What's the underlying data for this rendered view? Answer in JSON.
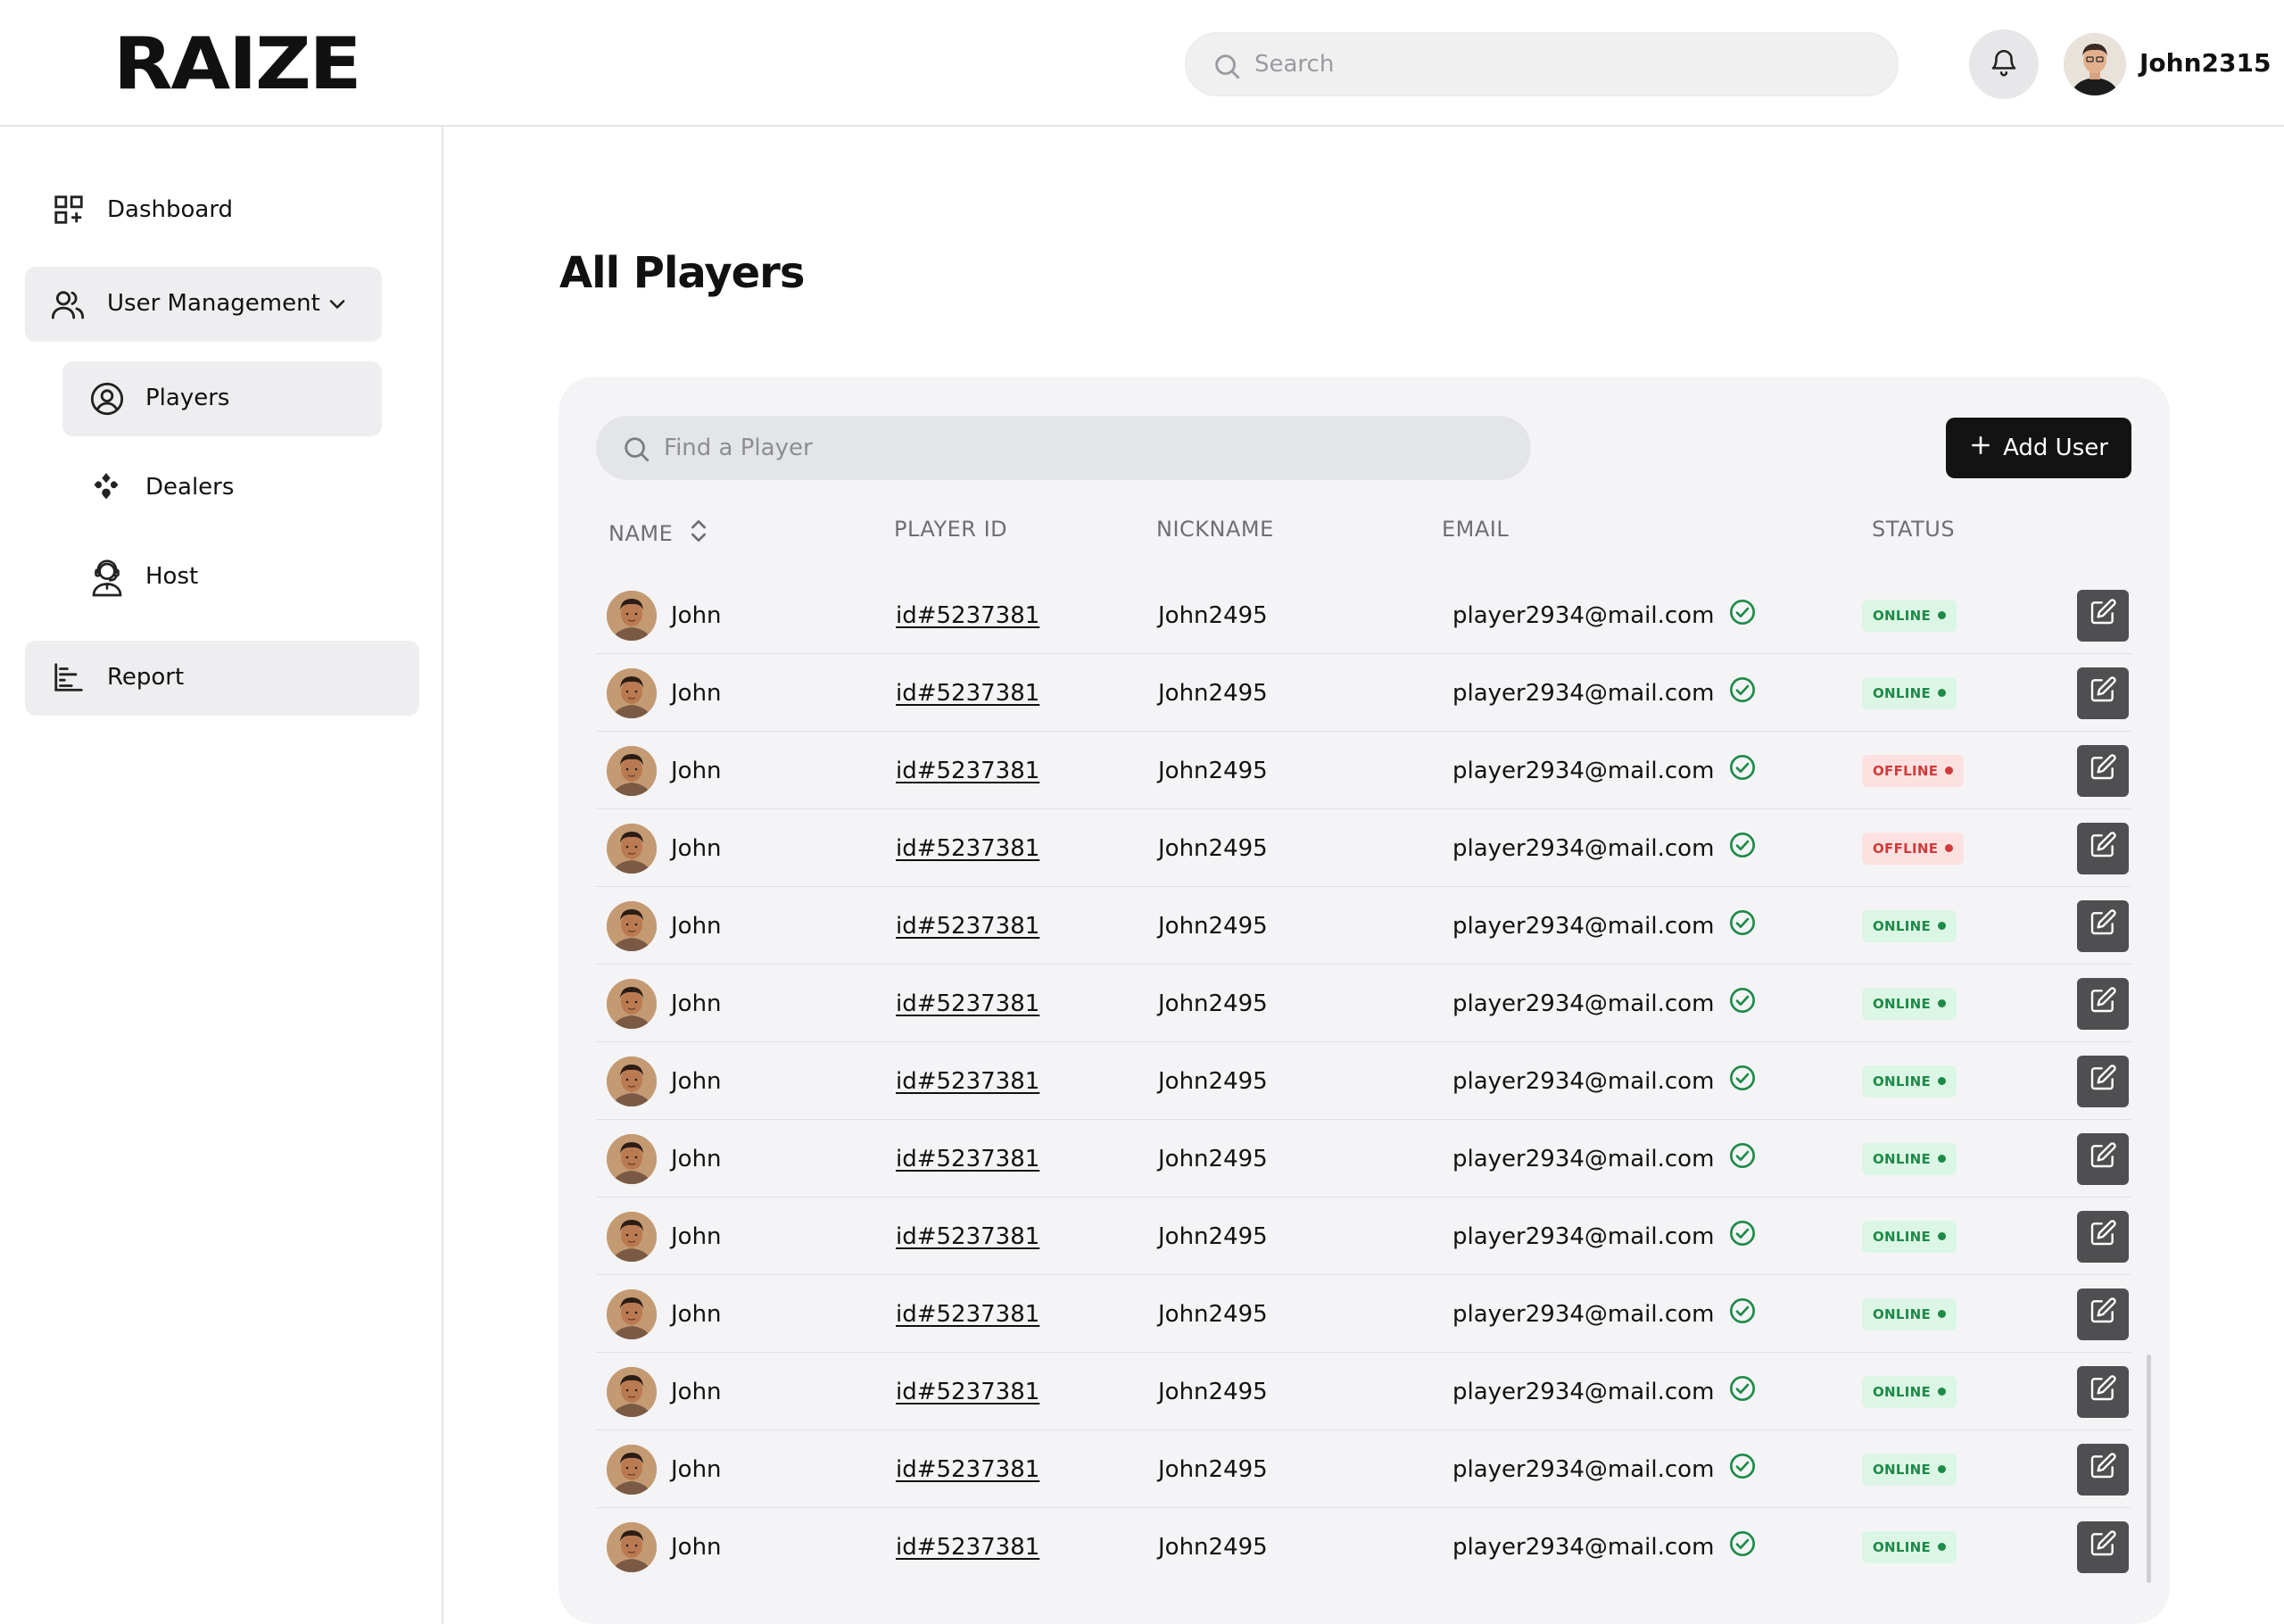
{
  "app": {
    "logo": "RAIZE"
  },
  "header": {
    "search_placeholder": "Search",
    "username": "John2315"
  },
  "sidebar": {
    "items": [
      {
        "label": "Dashboard",
        "icon": "dashboard-icon"
      },
      {
        "label": "User Management",
        "icon": "users-icon",
        "expanded": true
      },
      {
        "label": "Players",
        "icon": "user-circle-icon",
        "active": true
      },
      {
        "label": "Dealers",
        "icon": "cards-suit-icon"
      },
      {
        "label": "Host",
        "icon": "headset-user-icon"
      },
      {
        "label": "Report",
        "icon": "report-icon"
      }
    ]
  },
  "page": {
    "title": "All Players"
  },
  "toolbar": {
    "find_placeholder": "Find a Player",
    "add_label": "Add User"
  },
  "table": {
    "headers": {
      "name": "NAME",
      "player_id": "PLAYER ID",
      "nickname": "NICKNAME",
      "email": "EMAIL",
      "status": "STATUS"
    },
    "rows": [
      {
        "name": "John",
        "player_id": "id#5237381",
        "nickname": "John2495",
        "email": "player2934@mail.com",
        "status": "ONLINE"
      },
      {
        "name": "John",
        "player_id": "id#5237381",
        "nickname": "John2495",
        "email": "player2934@mail.com",
        "status": "ONLINE"
      },
      {
        "name": "John",
        "player_id": "id#5237381",
        "nickname": "John2495",
        "email": "player2934@mail.com",
        "status": "OFFLINE"
      },
      {
        "name": "John",
        "player_id": "id#5237381",
        "nickname": "John2495",
        "email": "player2934@mail.com",
        "status": "OFFLINE"
      },
      {
        "name": "John",
        "player_id": "id#5237381",
        "nickname": "John2495",
        "email": "player2934@mail.com",
        "status": "ONLINE"
      },
      {
        "name": "John",
        "player_id": "id#5237381",
        "nickname": "John2495",
        "email": "player2934@mail.com",
        "status": "ONLINE"
      },
      {
        "name": "John",
        "player_id": "id#5237381",
        "nickname": "John2495",
        "email": "player2934@mail.com",
        "status": "ONLINE"
      },
      {
        "name": "John",
        "player_id": "id#5237381",
        "nickname": "John2495",
        "email": "player2934@mail.com",
        "status": "ONLINE"
      },
      {
        "name": "John",
        "player_id": "id#5237381",
        "nickname": "John2495",
        "email": "player2934@mail.com",
        "status": "ONLINE"
      },
      {
        "name": "John",
        "player_id": "id#5237381",
        "nickname": "John2495",
        "email": "player2934@mail.com",
        "status": "ONLINE"
      },
      {
        "name": "John",
        "player_id": "id#5237381",
        "nickname": "John2495",
        "email": "player2934@mail.com",
        "status": "ONLINE"
      },
      {
        "name": "John",
        "player_id": "id#5237381",
        "nickname": "John2495",
        "email": "player2934@mail.com",
        "status": "ONLINE"
      },
      {
        "name": "John",
        "player_id": "id#5237381",
        "nickname": "John2495",
        "email": "player2934@mail.com",
        "status": "ONLINE"
      }
    ]
  },
  "colors": {
    "online_bg": "#dcf6e5",
    "online_text": "#1d8a48",
    "offline_bg": "#fde1e1",
    "offline_text": "#d23a3a",
    "verified": "#1d8a48",
    "primary_button": "#131313"
  }
}
